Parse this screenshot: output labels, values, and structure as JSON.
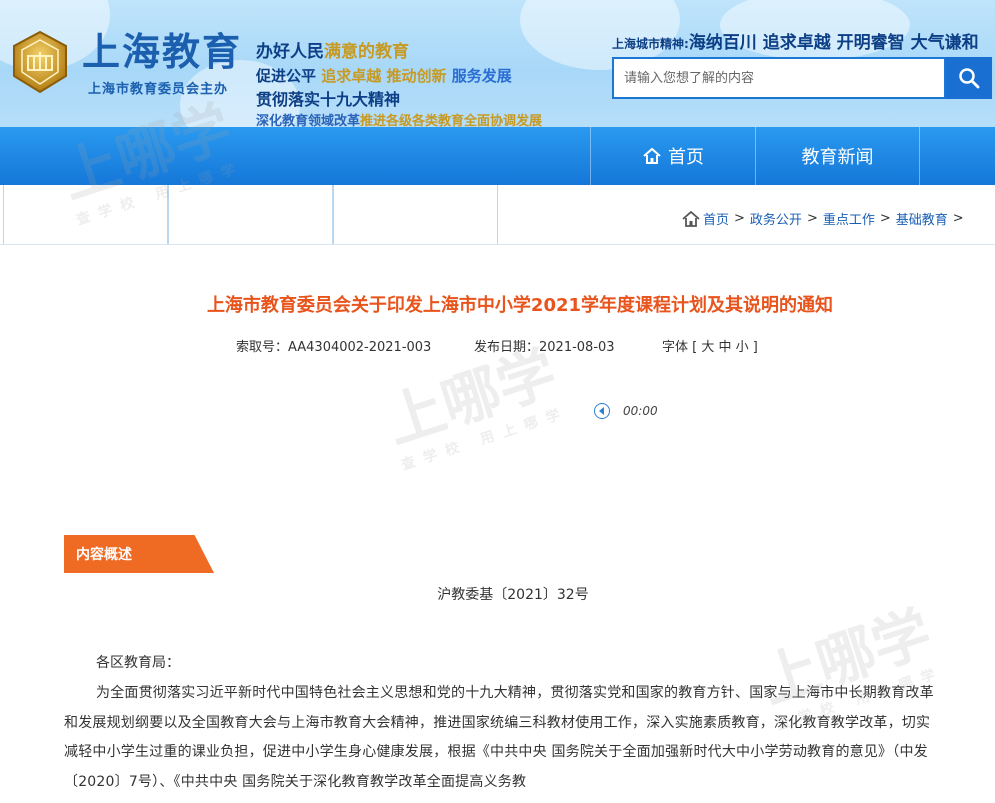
{
  "header": {
    "site_title": "上海教育",
    "site_subtitle": "上海市教育委员会主办",
    "slogans": {
      "line1_a": "办好人民",
      "line1_b": "满意的教育",
      "line2_a": "促进公平",
      "line2_b": "追求卓越",
      "line2_c": "推动创新",
      "line2_d": "服务发展",
      "line3": "贯彻落实十九大精神",
      "line4_a": "深化教育领域改革",
      "line4_b": "推进各级各类教育全面协调发展"
    },
    "city_spirit_label": "上海城市精神:",
    "city_spirit_value": "海纳百川 追求卓越 开明睿智 大气谦和",
    "search_placeholder": "请输入您想了解的内容",
    "search_icon": "search-icon",
    "logo_icon": "shanghai-education-emblem"
  },
  "nav": {
    "home_label": "首页",
    "home_icon": "home-icon",
    "news_label": "教育新闻"
  },
  "breadcrumb": {
    "icon": "home-icon",
    "items": [
      "首页",
      "政务公开",
      "重点工作",
      "基础教育"
    ],
    "separator": ">"
  },
  "article": {
    "title": "上海市教育委员会关于印发上海市中小学2021学年度课程计划及其说明的通知",
    "index_no": "索取号：AA4304002-2021-003",
    "publish_date": "发布日期：2021-08-03",
    "font_size": "字体 [ 大 中 小 ]",
    "audio_time": "00:00",
    "section_tag": "内容概述",
    "doc_number": "沪教委基〔2021〕32号",
    "salutation": "各区教育局：",
    "body": "为全面贯彻落实习近平新时代中国特色社会主义思想和党的十九大精神，贯彻落实党和国家的教育方针、国家与上海市中长期教育改革和发展规划纲要以及全国教育大会与上海市教育大会精神，推进国家统编三科教材使用工作，深入实施素质教育，深化教育教学改革，切实减轻中小学生过重的课业负担，促进中小学生身心健康发展，根据《中共中央 国务院关于全面加强新时代大中小学劳动教育的意见》（中发〔2020〕7号）、《中共中央 国务院关于深化教育教学改革全面提高义务教"
  },
  "watermark": {
    "big": "上哪学",
    "small": "查学校 用上哪学"
  },
  "colors": {
    "nav_blue": "#1a7ad9",
    "title_orange": "#e8541c",
    "tag_orange": "#ef6a23",
    "link_blue": "#1a5fb4"
  }
}
